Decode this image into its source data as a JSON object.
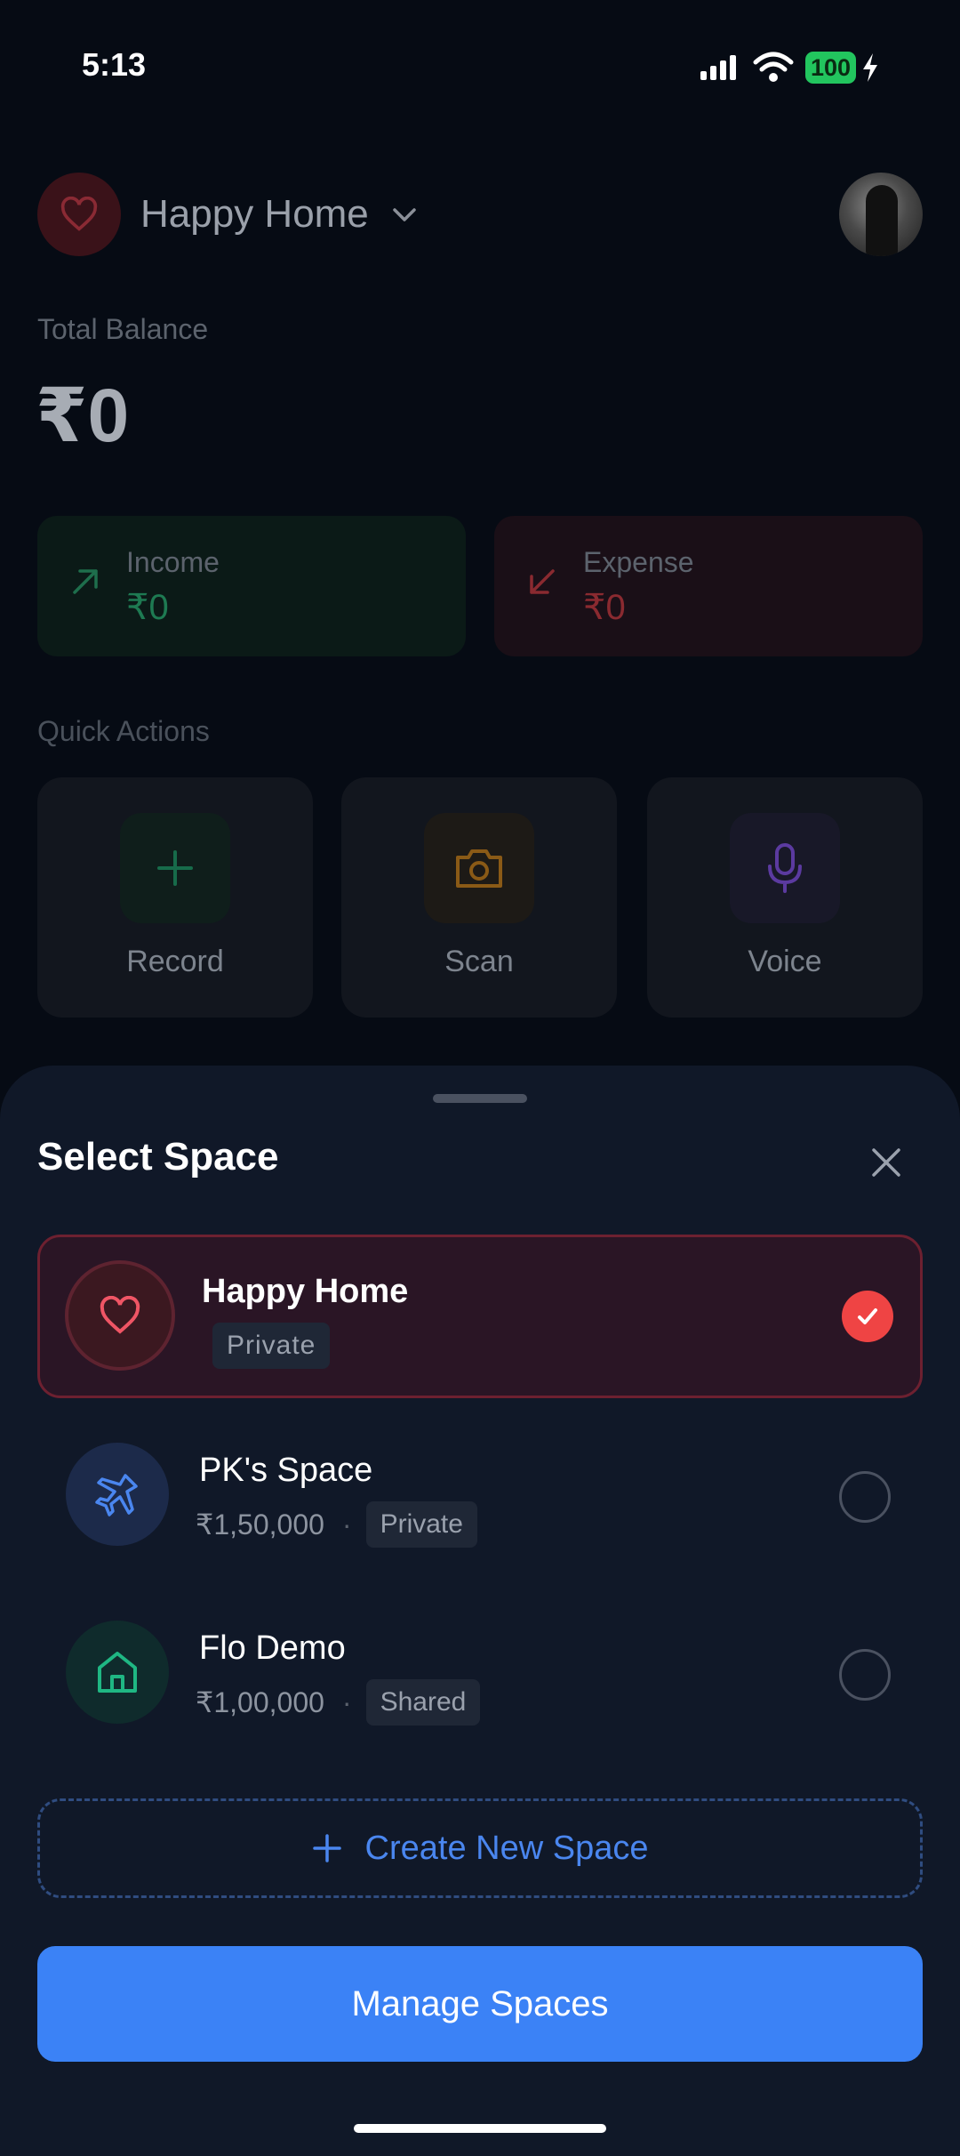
{
  "status": {
    "time": "5:13",
    "battery": "100"
  },
  "header": {
    "space_name": "Happy Home"
  },
  "balance": {
    "label": "Total Balance",
    "value": "₹0"
  },
  "cards": {
    "income": {
      "label": "Income",
      "value": "₹0"
    },
    "expense": {
      "label": "Expense",
      "value": "₹0"
    }
  },
  "quick_actions": {
    "title": "Quick Actions",
    "items": [
      {
        "label": "Record",
        "icon": "plus-icon"
      },
      {
        "label": "Scan",
        "icon": "camera-icon"
      },
      {
        "label": "Voice",
        "icon": "microphone-icon"
      }
    ]
  },
  "sheet": {
    "title": "Select Space",
    "spaces": [
      {
        "name": "Happy Home",
        "badge": "Private",
        "icon": "heart-icon",
        "selected": true
      },
      {
        "name": "PK's Space",
        "amount": "₹1,50,000",
        "separator": "·",
        "badge": "Private",
        "icon": "plane-icon",
        "selected": false
      },
      {
        "name": "Flo Demo",
        "amount": "₹1,00,000",
        "separator": "·",
        "badge": "Shared",
        "icon": "home-icon",
        "selected": false
      }
    ],
    "create_label": "Create New Space",
    "manage_label": "Manage Spaces"
  },
  "colors": {
    "accent_blue": "#3b82f6",
    "selected_red": "#ef4444",
    "sheet_bg": "#101828"
  }
}
